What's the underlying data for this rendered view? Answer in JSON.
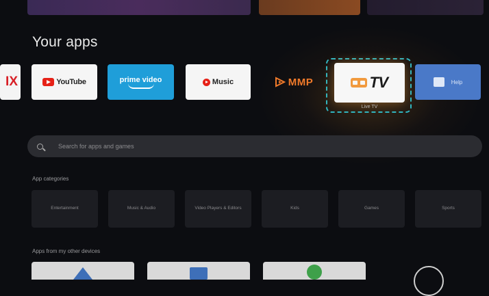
{
  "section_title": "Your apps",
  "apps": {
    "netflix": {
      "text": "IX"
    },
    "youtube": {
      "text": "YouTube"
    },
    "prime": {
      "text": "prime video"
    },
    "music": {
      "text": "Music"
    },
    "mmp": {
      "text": "MMP"
    },
    "tv": {
      "text": "TV",
      "caption": "Live TV"
    },
    "help": {
      "text": "Help"
    }
  },
  "search": {
    "placeholder": "Search for apps and games"
  },
  "categories": {
    "title": "App categories",
    "items": [
      "Entertainment",
      "Music & Audio",
      "Video Players & Editors",
      "Kids",
      "Games",
      "Sports"
    ]
  },
  "devices": {
    "title": "Apps from my other devices"
  },
  "colors": {
    "focus": "#2fb7c4",
    "accent_orange": "#f19a3e"
  }
}
